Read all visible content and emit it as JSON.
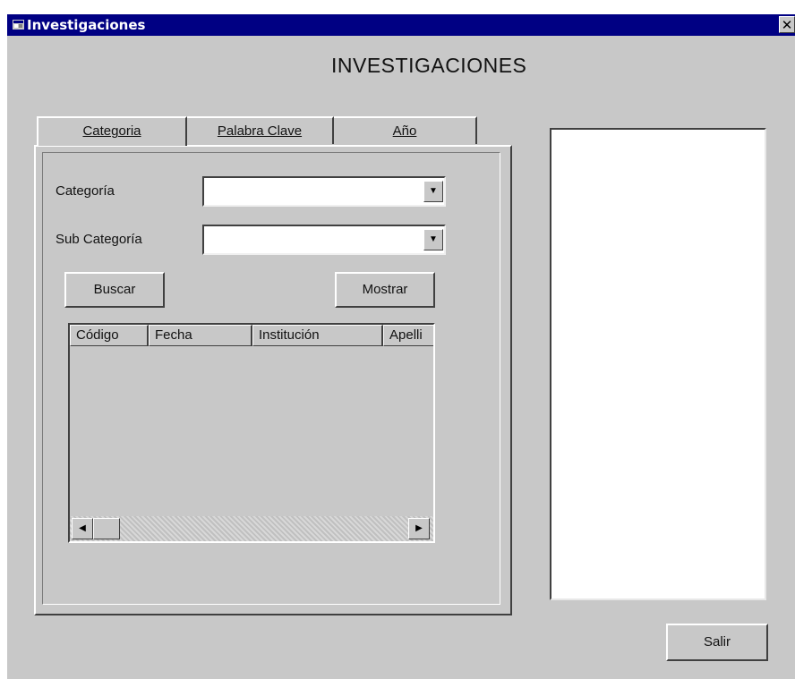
{
  "window": {
    "title": "Investigaciones",
    "close_glyph": "✕"
  },
  "heading": "INVESTIGACIONES",
  "tabs": [
    {
      "label": "Categoria",
      "active": true
    },
    {
      "label": "Palabra Clave",
      "active": false
    },
    {
      "label": "Año",
      "active": false
    }
  ],
  "form": {
    "categoria_label": "Categoría",
    "subcategoria_label": "Sub Categoría",
    "categoria_value": "",
    "subcategoria_value": "",
    "dropdown_glyph": "▼"
  },
  "buttons": {
    "buscar": "Buscar",
    "mostrar": "Mostrar",
    "salir": "Salir"
  },
  "grid": {
    "columns": [
      "Código",
      "Fecha",
      "Institución",
      "Apelli"
    ],
    "rows": [],
    "scroll_left_glyph": "◀",
    "scroll_right_glyph": "▶"
  },
  "icons": {
    "app": "window-app-icon",
    "close": "close-icon"
  }
}
